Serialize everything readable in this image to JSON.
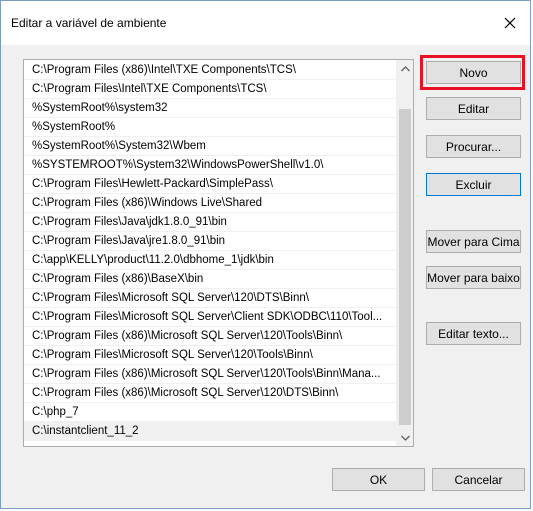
{
  "window": {
    "title": "Editar a variável de ambiente"
  },
  "list": {
    "items": [
      "C:\\Program Files (x86)\\Intel\\TXE Components\\TCS\\",
      "C:\\Program Files\\Intel\\TXE Components\\TCS\\",
      "%SystemRoot%\\system32",
      "%SystemRoot%",
      "%SystemRoot%\\System32\\Wbem",
      "%SYSTEMROOT%\\System32\\WindowsPowerShell\\v1.0\\",
      "C:\\Program Files\\Hewlett-Packard\\SimplePass\\",
      "C:\\Program Files (x86)\\Windows Live\\Shared",
      "C:\\Program Files\\Java\\jdk1.8.0_91\\bin",
      "C:\\Program Files\\Java\\jre1.8.0_91\\bin",
      "C:\\app\\KELLY\\product\\11.2.0\\dbhome_1\\jdk\\bin",
      "C:\\Program Files (x86)\\BaseX\\bin",
      "C:\\Program Files\\Microsoft SQL Server\\120\\DTS\\Binn\\",
      "C:\\Program Files\\Microsoft SQL Server\\Client SDK\\ODBC\\110\\Tool...",
      "C:\\Program Files (x86)\\Microsoft SQL Server\\120\\Tools\\Binn\\",
      "C:\\Program Files\\Microsoft SQL Server\\120\\Tools\\Binn\\",
      "C:\\Program Files (x86)\\Microsoft SQL Server\\120\\Tools\\Binn\\Mana...",
      "C:\\Program Files (x86)\\Microsoft SQL Server\\120\\DTS\\Binn\\",
      "C:\\php_7",
      "C:\\instantclient_11_2"
    ],
    "selected_index": 19
  },
  "buttons": {
    "novo": "Novo",
    "editar": "Editar",
    "procurar": "Procurar...",
    "excluir": "Excluir",
    "mover_cima": "Mover para Cima",
    "mover_baixo": "Mover para baixo",
    "editar_texto": "Editar texto...",
    "ok": "OK",
    "cancelar": "Cancelar"
  },
  "colors": {
    "highlight": "#e81123",
    "focus_border": "#0078d7"
  },
  "icons": {
    "close": "close-icon",
    "scroll_up": "chevron-up-icon",
    "scroll_down": "chevron-down-icon"
  }
}
